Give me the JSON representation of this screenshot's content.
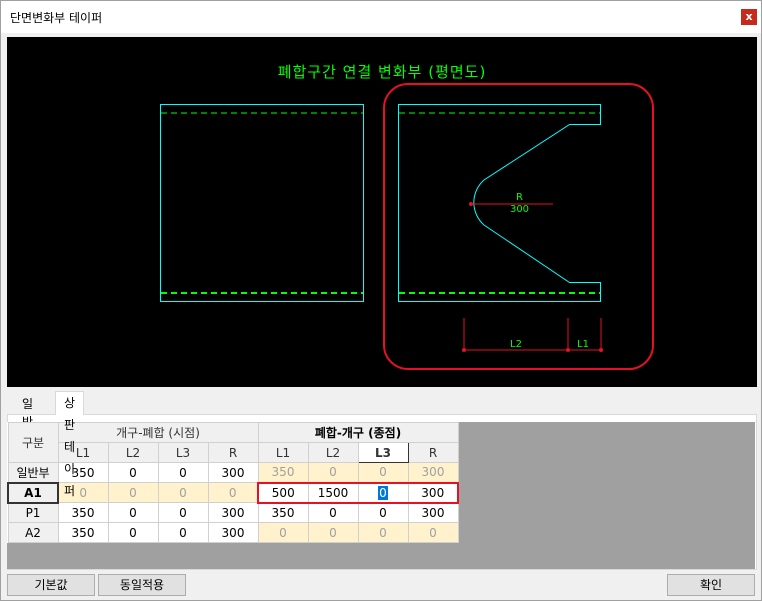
{
  "window": {
    "title": "단면변화부 테이퍼",
    "close_glyph": "x"
  },
  "diagram": {
    "title": "폐합구간 연결 변화부 (평면도)",
    "r_label": "R",
    "r_value": "300",
    "l2_label": "L2",
    "l1_label": "L1",
    "colors": {
      "outline": "#00ffff",
      "dash": "#00ff00",
      "dimension": "#e81123",
      "highlight": "#e81123",
      "text": "#00ff00"
    }
  },
  "tabs": [
    {
      "label": "일반",
      "active": false
    },
    {
      "label": "상판 테이퍼",
      "active": true
    }
  ],
  "table": {
    "corner_label": "구분",
    "group1": "개구-폐합 (시점)",
    "group2": "폐합-개구 (종점)",
    "columns": [
      "L1",
      "L2",
      "L3",
      "R",
      "L1",
      "L2",
      "L3",
      "R"
    ],
    "rows": [
      {
        "label": "일반부",
        "values": [
          "350",
          "0",
          "0",
          "300",
          "350",
          "0",
          "0",
          "300"
        ]
      },
      {
        "label": "A1",
        "values": [
          "0",
          "0",
          "0",
          "0",
          "500",
          "1500",
          "0",
          "300"
        ]
      },
      {
        "label": "P1",
        "values": [
          "350",
          "0",
          "0",
          "300",
          "350",
          "0",
          "0",
          "300"
        ]
      },
      {
        "label": "A2",
        "values": [
          "350",
          "0",
          "0",
          "300",
          "0",
          "0",
          "0",
          "0"
        ]
      }
    ]
  },
  "buttons": {
    "default": "기본값",
    "apply_same": "동일적용",
    "ok": "확인"
  }
}
